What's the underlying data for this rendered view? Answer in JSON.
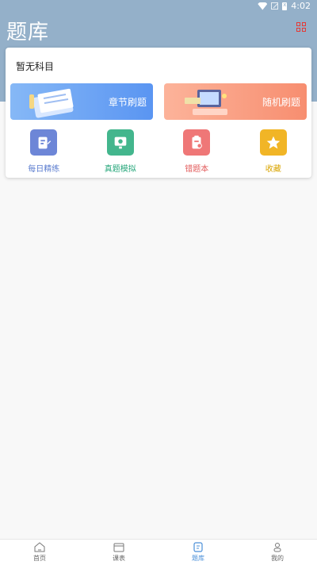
{
  "status_bar": {
    "time": "4:02"
  },
  "header": {
    "title": "题库"
  },
  "card": {
    "subject": "暂无科目",
    "banners": [
      {
        "label": "章节刷题"
      },
      {
        "label": "随机刷题"
      }
    ],
    "quick_actions": [
      {
        "label": "每日精练",
        "color": "#5b7ccf",
        "bg": "#6d86d7",
        "icon": "edit-icon"
      },
      {
        "label": "真题模拟",
        "color": "#27a77b",
        "bg": "#43b68d",
        "icon": "monitor-icon"
      },
      {
        "label": "错题本",
        "color": "#e25b5b",
        "bg": "#ef7777",
        "icon": "clipboard-icon"
      },
      {
        "label": "收藏",
        "color": "#d9a400",
        "bg": "#f1b526",
        "icon": "star-icon"
      }
    ]
  },
  "bottom_nav": {
    "items": [
      {
        "label": "首页",
        "icon": "home-icon"
      },
      {
        "label": "课表",
        "icon": "calendar-icon"
      },
      {
        "label": "题库",
        "icon": "question-bank-icon",
        "active": true
      },
      {
        "label": "我的",
        "icon": "profile-icon"
      }
    ]
  }
}
